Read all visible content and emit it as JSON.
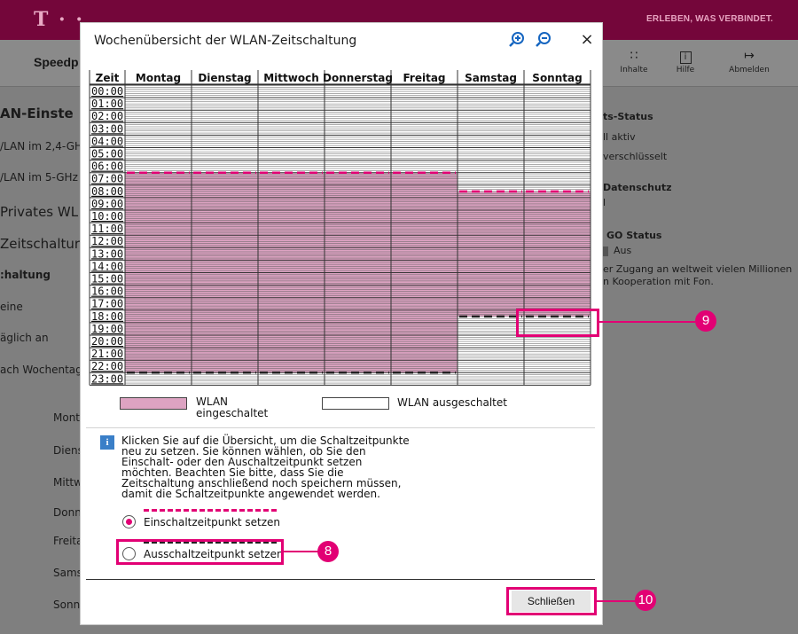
{
  "header": {
    "logo": "T · ·",
    "tagline": "ERLEBEN, WAS VERBINDET.",
    "page_label": "Speedp",
    "nav": [
      {
        "label": "Inhalte",
        "icon": "sitemap-icon"
      },
      {
        "label": "Hilfe",
        "icon": "info-icon"
      },
      {
        "label": "Abmelden",
        "icon": "logout-icon"
      }
    ]
  },
  "background_left": {
    "items": [
      "AN-Einste",
      "/LAN im 2,4-GH",
      "/LAN im 5-GHz",
      "Privates WL",
      "Zeitschaltur",
      ":haltung",
      "eine",
      "äglich an",
      "ach Wochentag",
      "Mont",
      "Diens",
      "Mittw",
      "Donn",
      "Freita",
      "Sams",
      "Sonn"
    ]
  },
  "background_right": {
    "items": [
      "ts-Status",
      "ll aktiv",
      "verschlüsselt",
      "Datenschutz",
      "l",
      "GO Status",
      "Aus",
      "er Zugang an weltweit vielen Millionen",
      "n Kooperation mit Fon."
    ]
  },
  "dialog": {
    "title": "Wochenübersicht der WLAN-Zeitschaltung",
    "close_glyph": "×",
    "columns": [
      "Zeit",
      "Montag",
      "Dienstag",
      "Mittwoch",
      "Donnerstag",
      "Freitag",
      "Samstag",
      "Sonntag"
    ],
    "times": [
      "00:00",
      "01:00",
      "02:00",
      "03:00",
      "04:00",
      "05:00",
      "06:00",
      "07:00",
      "08:00",
      "09:00",
      "10:00",
      "11:00",
      "12:00",
      "13:00",
      "14:00",
      "15:00",
      "16:00",
      "17:00",
      "18:00",
      "19:00",
      "20:00",
      "21:00",
      "22:00",
      "23:00"
    ],
    "schedule": [
      {
        "day": "Montag",
        "on": "07:00",
        "off": "23:00"
      },
      {
        "day": "Dienstag",
        "on": "07:00",
        "off": "23:00"
      },
      {
        "day": "Mittwoch",
        "on": "07:00",
        "off": "23:00"
      },
      {
        "day": "Donnerstag",
        "on": "07:00",
        "off": "23:00"
      },
      {
        "day": "Freitag",
        "on": "07:00",
        "off": "23:00"
      },
      {
        "day": "Samstag",
        "on": "08:30",
        "off": "18:30"
      },
      {
        "day": "Sonntag",
        "on": "08:30",
        "off": "18:30"
      }
    ],
    "legend": {
      "on": "WLAN eingeschaltet",
      "off": "WLAN ausgeschaltet"
    },
    "info_icon": "i",
    "info_text": "Klicken Sie auf die Übersicht, um die Schaltzeitpunkte neu zu setzen. Sie können wählen, ob Sie den Einschalt- oder den Auschaltzeitpunkt setzen möchten. Beachten Sie bitte, dass Sie die Zeitschaltung anschließend noch speichern müssen, damit die Schaltzeitpunkte angewendet werden.",
    "radio_on": "Einschaltzeitpunkt setzen",
    "radio_off": "Ausschaltzeitpunkt setzen",
    "selected": "on",
    "close_button": "Schließen"
  },
  "callouts": [
    "8",
    "9",
    "10"
  ],
  "colors": {
    "magenta": "#e20074",
    "on_fill": "#dda3c2",
    "topbar": "#74063a"
  }
}
